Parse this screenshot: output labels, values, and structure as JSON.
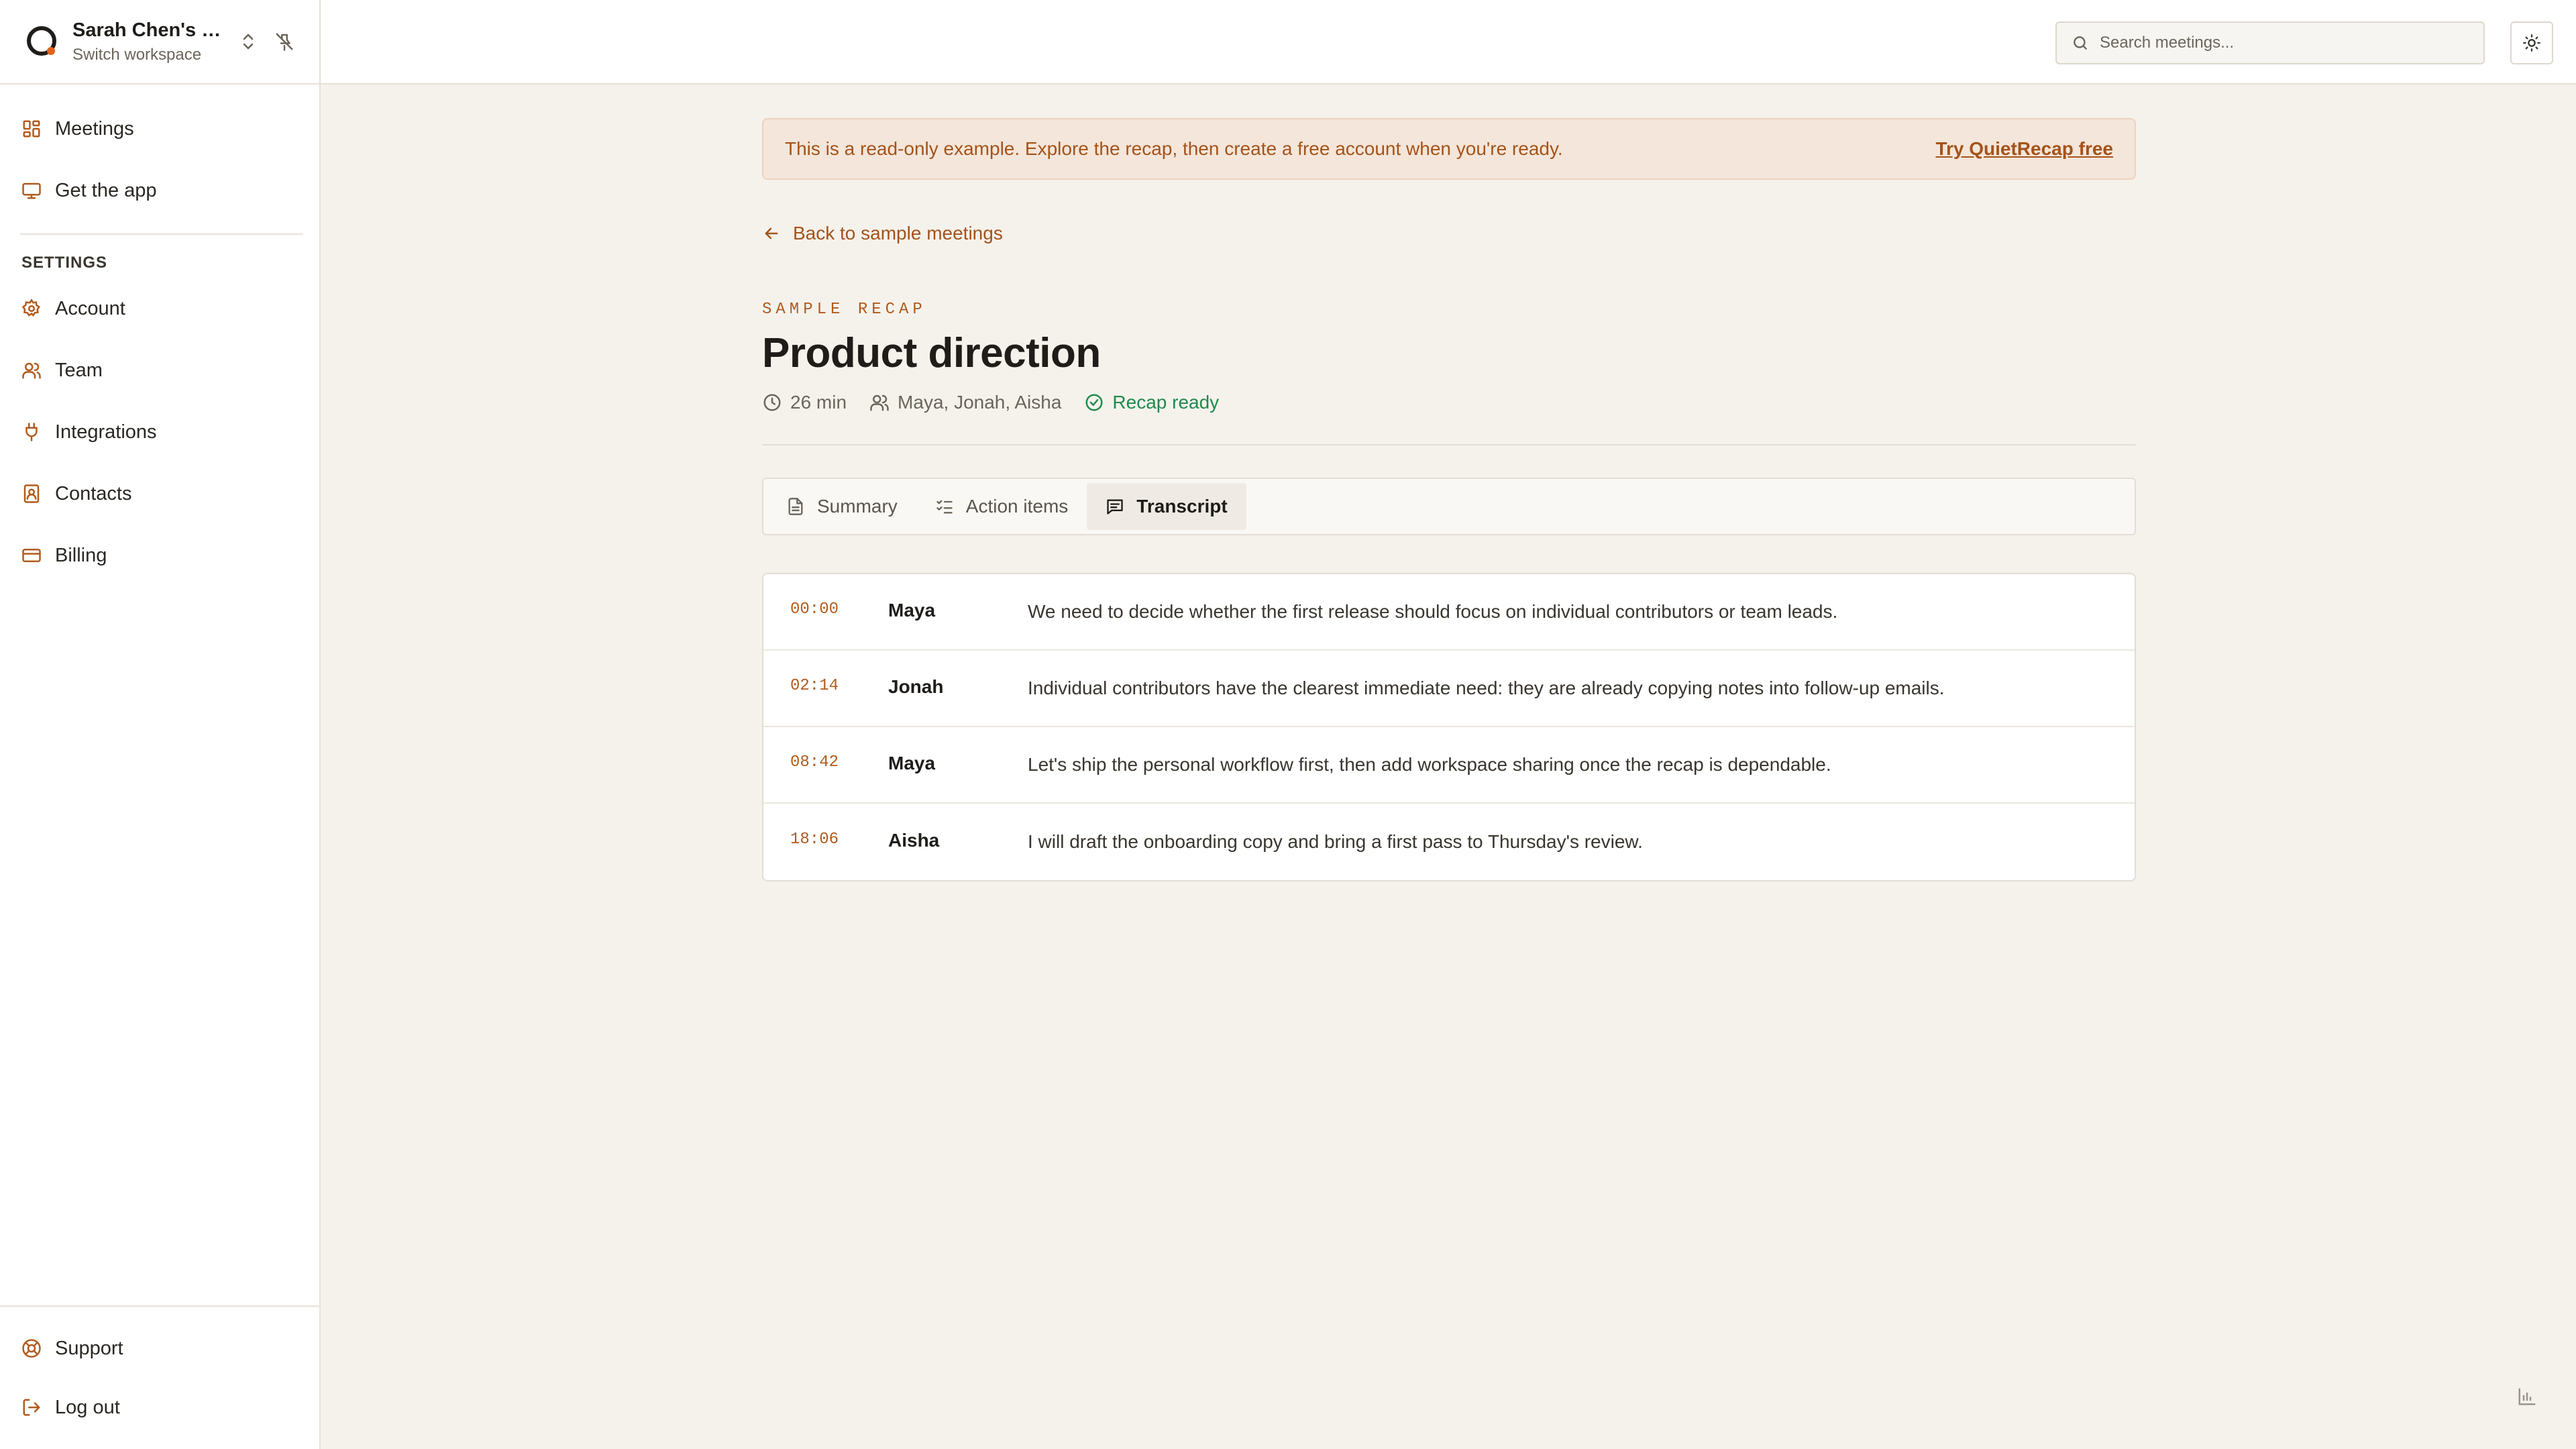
{
  "workspace": {
    "name": "Sarah Chen's W...",
    "switch_label": "Switch workspace"
  },
  "sidebar": {
    "items": [
      {
        "label": "Meetings",
        "icon": "grid-icon"
      },
      {
        "label": "Get the app",
        "icon": "monitor-icon"
      }
    ],
    "settings_heading": "SETTINGS",
    "settings_items": [
      {
        "label": "Account",
        "icon": "gear-icon"
      },
      {
        "label": "Team",
        "icon": "users-icon"
      },
      {
        "label": "Integrations",
        "icon": "plug-icon"
      },
      {
        "label": "Contacts",
        "icon": "contact-book-icon"
      },
      {
        "label": "Billing",
        "icon": "credit-card-icon"
      }
    ],
    "bottom_items": [
      {
        "label": "Support",
        "icon": "lifebuoy-icon"
      },
      {
        "label": "Log out",
        "icon": "logout-icon"
      }
    ]
  },
  "topbar": {
    "search_placeholder": "Search meetings..."
  },
  "banner": {
    "message": "This is a read-only example. Explore the recap, then create a free account when you're ready.",
    "cta": "Try QuietRecap free"
  },
  "back_link": "Back to sample meetings",
  "eyebrow": "SAMPLE RECAP",
  "title": "Product direction",
  "meta": {
    "duration": "26 min",
    "participants": "Maya, Jonah, Aisha",
    "status": "Recap ready"
  },
  "tabs": [
    {
      "label": "Summary",
      "active": false
    },
    {
      "label": "Action items",
      "active": false
    },
    {
      "label": "Transcript",
      "active": true
    }
  ],
  "transcript": [
    {
      "time": "00:00",
      "speaker": "Maya",
      "text": "We need to decide whether the first release should focus on individual contributors or team leads."
    },
    {
      "time": "02:14",
      "speaker": "Jonah",
      "text": "Individual contributors have the clearest immediate need: they are already copying notes into follow-up emails."
    },
    {
      "time": "08:42",
      "speaker": "Maya",
      "text": "Let's ship the personal workflow first, then add workspace sharing once the recap is dependable."
    },
    {
      "time": "18:06",
      "speaker": "Aisha",
      "text": "I will draft the onboarding copy and bring a first pass to Thursday's review."
    }
  ],
  "colors": {
    "accent": "#b15a1c",
    "success": "#1f8a4c",
    "background": "#f5f2ec"
  }
}
